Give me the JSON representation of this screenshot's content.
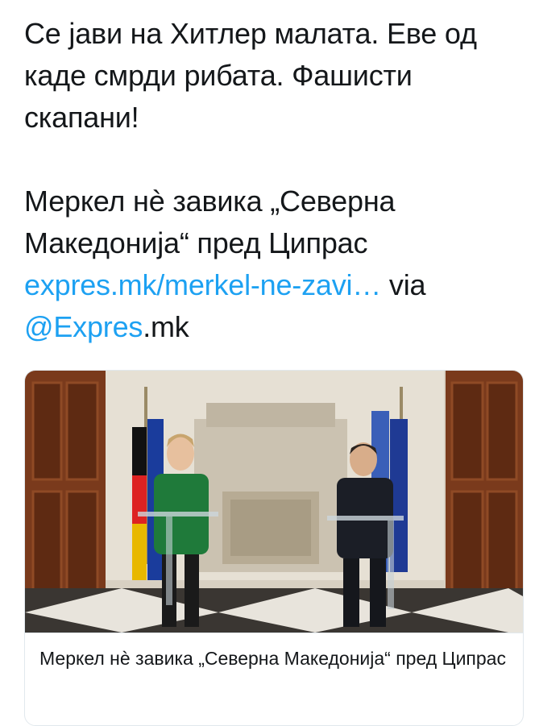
{
  "tweet": {
    "line1": "Се јави на Хитлер малата. Еве од каде смрди рибата. Фашисти скапани!",
    "headline": "Меркел нè завика „Северна Македонија“ пред Ципрас",
    "link_text": "expres.mk/merkel-ne-zavi…",
    "via_text": " via ",
    "mention": "@Expres",
    "mention_suffix": ".mk"
  },
  "card": {
    "image_alt": "Merkel and Tsipras press conference",
    "title": "Меркел нè завика „Северна Македонија“ пред Ципрас"
  },
  "colors": {
    "link": "#1da1f2",
    "text": "#14171a",
    "border": "#e1e8ed"
  }
}
